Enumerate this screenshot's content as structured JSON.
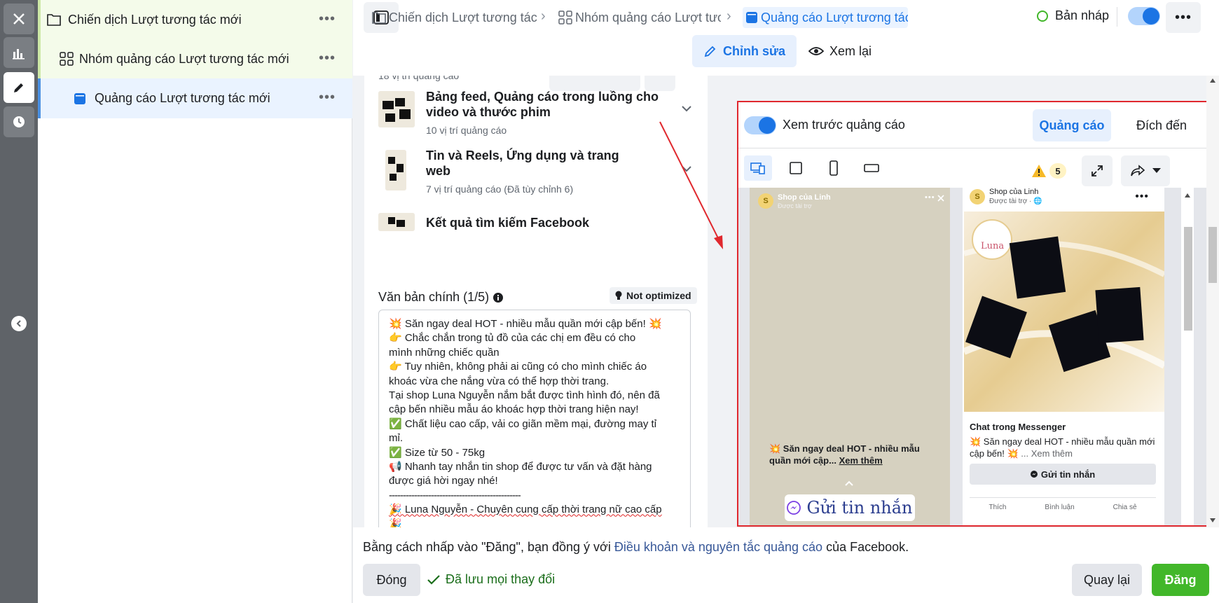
{
  "colors": {
    "accent": "#1b74e4",
    "publish": "#42b72a",
    "highlight_frame": "#e0282e"
  },
  "rail": {
    "icons": [
      "close-icon",
      "chart-icon",
      "pencil-icon",
      "clock-icon",
      "chevron-left-icon"
    ]
  },
  "tree": {
    "campaign": {
      "label": "Chiến dịch Lượt tương tác mới",
      "icon": "folder-icon"
    },
    "adset": {
      "label": "Nhóm quảng cáo Lượt tương tác mới",
      "icon": "grid-icon"
    },
    "ad": {
      "label": "Quảng cáo Lượt tương tác mới",
      "icon": "ad-square-icon"
    },
    "more": "•••"
  },
  "header": {
    "breadcrumbs": [
      "Chiến dịch Lượt tương tác mới",
      "Nhóm quảng cáo Lượt tương tác mới",
      "Quảng cáo Lượt tương tác mới"
    ],
    "status": "Bản nháp",
    "more": "•••",
    "modes": {
      "edit": "Chỉnh sửa",
      "review": "Xem lại"
    }
  },
  "form": {
    "total_placements": "18 vị trí quảng cáo",
    "hidden_button": "Chỉnh sửa",
    "placements": [
      {
        "title_line1": "Bảng feed, Quảng cáo trong luồng cho",
        "title_line2": "video và thước phim",
        "sub": "10 vị trí quảng cáo"
      },
      {
        "title_line1": "Tin và Reels, Ứng dụng và trang",
        "title_line2": "web",
        "sub": "7 vị trí quảng cáo (Đã tùy chỉnh 6)"
      },
      {
        "title_line1": "Kết quả tìm kiếm Facebook",
        "title_line2": "",
        "sub": ""
      }
    ],
    "primary_text_label": "Văn bản chính (1/5)",
    "not_optimized": "Not optimized",
    "primary_text_lines": [
      "💥 Săn ngay deal HOT - nhiều mẫu quần mới cập bến! 💥",
      "👉 Chắc chắn trong tủ đồ của các chị em đều có cho",
      "mình những chiếc quần",
      "👉 Tuy nhiên, không phải ai cũng có cho mình chiếc áo",
      "khoác vừa che nắng vừa có thể hợp thời trang.",
      "Tại shop Luna Nguyễn nắm bắt được tình hình đó, nên đã",
      "cập bến nhiều mẫu áo khoác hợp thời trang hiện nay!",
      "✅ Chất liệu cao cấp, vải co giãn mềm mại, đường may tỉ",
      "mỉ.",
      "✅ Size từ 50 - 75kg",
      "📢 Nhanh tay nhắn tin shop để được tư vấn và đặt hàng",
      "được giá hời ngay nhé!",
      "-----------------------------------------------",
      "🎉 Luna Nguyễn - Chuyên cung cấp thời trang nữ cao cấp",
      "🎉"
    ]
  },
  "preview": {
    "toggle_label": "Xem trước quảng cáo",
    "tab_ad": "Quảng cáo",
    "tab_destination": "Đích đến",
    "warning_count": "5",
    "story": {
      "avatar": "S",
      "page_name": "Shop của Linh",
      "sponsored": "Được tài trợ",
      "caption": "💥 Săn ngay deal HOT - nhiều mẫu quần mới cập...",
      "see_more": "Xem thêm",
      "cta": "Gửi tin nhắn"
    },
    "feed": {
      "avatar": "S",
      "page_name": "Shop của Linh",
      "sponsored": "Được tài trợ · 🌐",
      "brand": "Luna",
      "cta_title": "Chat trong Messenger",
      "text": "💥 Săn ngay deal HOT - nhiều mẫu quần mới cập bến! 💥",
      "see_more": "... Xem thêm",
      "send": "Gửi tin nhắn",
      "actions": [
        "Thích",
        "Bình luận",
        "Chia sẻ"
      ]
    }
  },
  "footer": {
    "legal_prefix": "Bằng cách nhấp vào \"Đăng\", bạn đồng ý với ",
    "legal_link": "Điều khoản và nguyên tắc quảng cáo",
    "legal_suffix": " của Facebook.",
    "close": "Đóng",
    "saved": "Đã lưu mọi thay đổi",
    "back": "Quay lại",
    "publish": "Đăng"
  }
}
